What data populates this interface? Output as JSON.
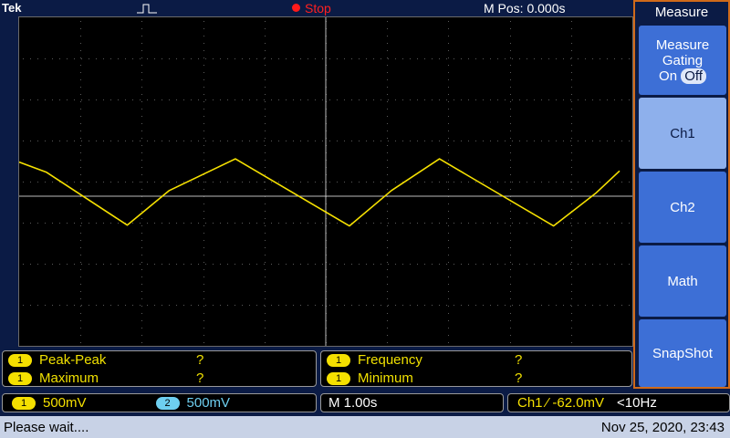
{
  "header": {
    "brand": "Tek",
    "run_state": "Stop",
    "horizontal_position": "M Pos: 0.000s"
  },
  "colors": {
    "ch1": "#f5e000",
    "ch2": "#6ecff0",
    "panel_accent": "#d06a1a",
    "button": "#3d6fd6"
  },
  "side_menu": {
    "title": "Measure",
    "gating_label": "Measure Gating",
    "gating_on": "On",
    "gating_off": "Off",
    "ch1": "Ch1",
    "ch2": "Ch2",
    "math": "Math",
    "snapshot": "SnapShot"
  },
  "measurements": [
    {
      "channel": "1",
      "name": "Peak-Peak",
      "value": "?"
    },
    {
      "channel": "1",
      "name": "Maximum",
      "value": "?"
    },
    {
      "channel": "1",
      "name": "Frequency",
      "value": "?"
    },
    {
      "channel": "1",
      "name": "Minimum",
      "value": "?"
    }
  ],
  "status": {
    "ch1_badge": "1",
    "ch1_scale": "500mV",
    "ch2_badge": "2",
    "ch2_scale": "500mV",
    "timebase": "M 1.00s",
    "trigger": "Ch1 ⁄ -62.0mV",
    "trigger_freq": "<10Hz"
  },
  "message": "Please wait....",
  "datetime": "Nov 25, 2020, 23:43",
  "waveform": {
    "points": [
      [
        0,
        0.85
      ],
      [
        0.045,
        0.6
      ],
      [
        0.18,
        -0.72
      ],
      [
        0.25,
        0.14
      ],
      [
        0.36,
        0.93
      ],
      [
        0.55,
        -0.74
      ],
      [
        0.62,
        0.14
      ],
      [
        0.7,
        0.93
      ],
      [
        0.89,
        -0.74
      ],
      [
        0.96,
        0.07
      ],
      [
        1.0,
        0.63
      ]
    ]
  }
}
